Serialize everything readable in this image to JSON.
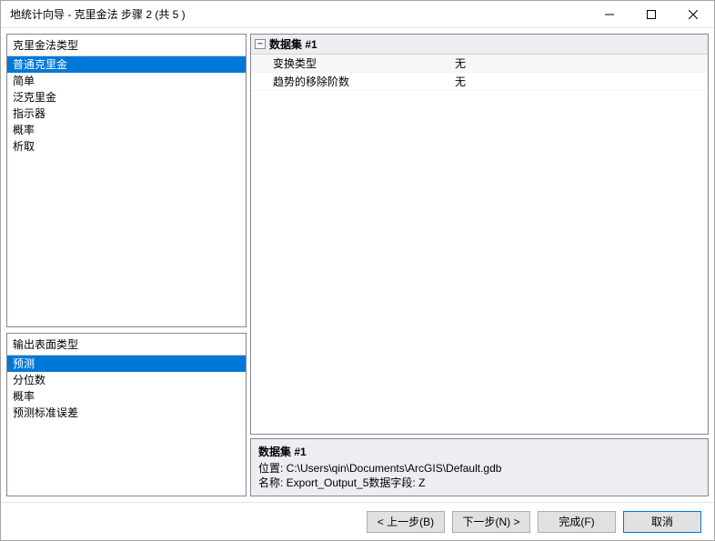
{
  "window": {
    "title": "地统计向导 - 克里金法 步骤 2 (共 5 )"
  },
  "left": {
    "kriging_header": "克里金法类型",
    "kriging_items": [
      "普通克里金",
      "简单",
      "泛克里金",
      "指示器",
      "概率",
      "析取"
    ],
    "output_header": "输出表面类型",
    "output_items": [
      "预测",
      "分位数",
      "概率",
      "预测标准误差"
    ]
  },
  "grid": {
    "section": "数据集 #1",
    "rows": [
      {
        "label": "变换类型",
        "value": "无"
      },
      {
        "label": "趋势的移除阶数",
        "value": "无"
      }
    ]
  },
  "info": {
    "title": "数据集 #1",
    "line1": "位置: C:\\Users\\qin\\Documents\\ArcGIS\\Default.gdb",
    "line2": "名称: Export_Output_5数据字段: Z"
  },
  "footer": {
    "back": "< 上一步(B)",
    "next": "下一步(N) >",
    "finish": "完成(F)",
    "cancel": "取消"
  }
}
